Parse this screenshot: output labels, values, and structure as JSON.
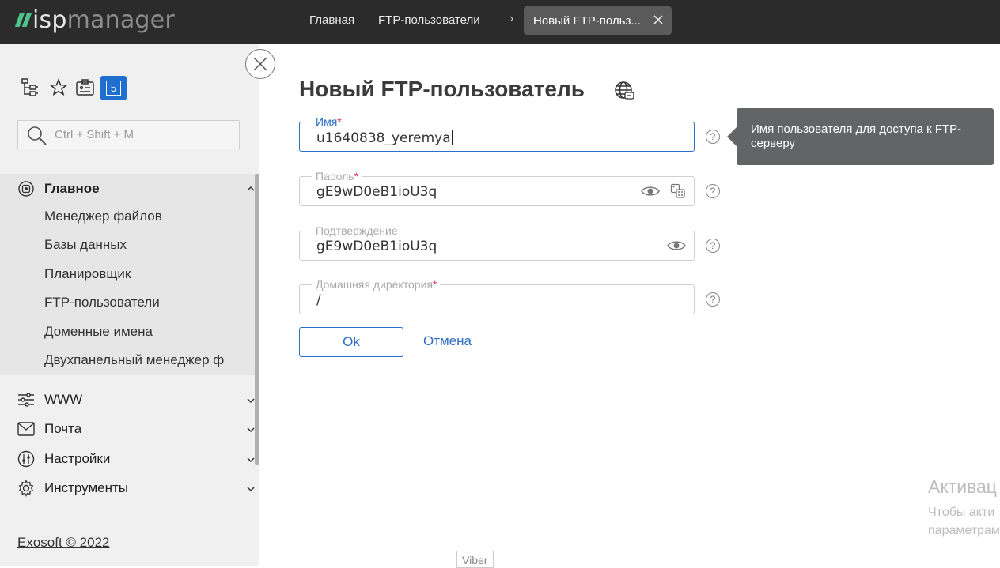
{
  "header": {
    "logo_isp": "isp",
    "logo_manager": "manager",
    "breadcrumbs": [
      "Главная",
      "FTP-пользователи"
    ],
    "active_tab": "Новый FTP-польз..."
  },
  "sidebar": {
    "search_placeholder": "Ctrl + Shift + M",
    "badge_count": "5",
    "groups": [
      {
        "label": "Главное",
        "expanded": true,
        "items": [
          "Менеджер файлов",
          "Базы данных",
          "Планировщик",
          "FTP-пользователи",
          "Доменные имена",
          "Двухпанельный менеджер ф"
        ]
      },
      {
        "label": "WWW",
        "expanded": false
      },
      {
        "label": "Почта",
        "expanded": false
      },
      {
        "label": "Настройки",
        "expanded": false
      },
      {
        "label": "Инструменты",
        "expanded": false
      }
    ],
    "footer": "Exosoft © 2022"
  },
  "form": {
    "title": "Новый FTP-пользователь",
    "fields": [
      {
        "label": "Имя",
        "required": "*",
        "value": "u1640838_yeremya"
      },
      {
        "label": "Пароль",
        "required": "*",
        "value": "gE9wD0eB1ioU3q"
      },
      {
        "label": "Подтверждение",
        "required": "",
        "value": "gE9wD0eB1ioU3q"
      },
      {
        "label": "Домашняя директория",
        "required": "*",
        "value": "/"
      }
    ],
    "help_symbol": "?",
    "ok_label": "Ok",
    "cancel_label": "Отмена",
    "tooltip": "Имя пользователя для доступа к FTP-серверу"
  },
  "overlay": {
    "activate_title": "Активац",
    "activate_line1": "Чтобы акти",
    "activate_line2": "параметрам",
    "viber": "Viber"
  },
  "colors": {
    "accent": "#2f6ec5",
    "topbar": "#2b2b2b",
    "sidebar": "#f0f0f0",
    "logo_green": "#4cc38a",
    "required": "#d9366c"
  }
}
